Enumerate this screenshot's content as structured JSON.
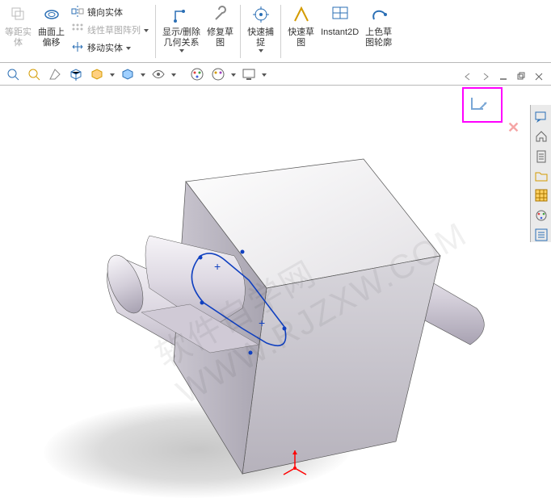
{
  "ribbon": {
    "offset_entity": "等距实\n体",
    "surface_offset": "曲面上\n偏移",
    "mirror_entity": "镜向实体",
    "linear_pattern": "线性草图阵列",
    "move_entity": "移动实体",
    "show_hide_rel": "显示/删除\n几何关系",
    "repair_sketch": "修复草\n图",
    "quick_snap": "快速捕\n捉",
    "quick_sketch": "快速草\n图",
    "instant2d": "Instant2D",
    "sketch_contour": "上色草\n图轮廓"
  },
  "watermark_text": "软件自学网\nWWW.RJZXW.COM",
  "right_panel": {
    "icons": [
      "feedback-icon",
      "home-icon",
      "doc-icon",
      "folder-icon",
      "table-icon",
      "appearance-icon",
      "list-icon"
    ]
  }
}
